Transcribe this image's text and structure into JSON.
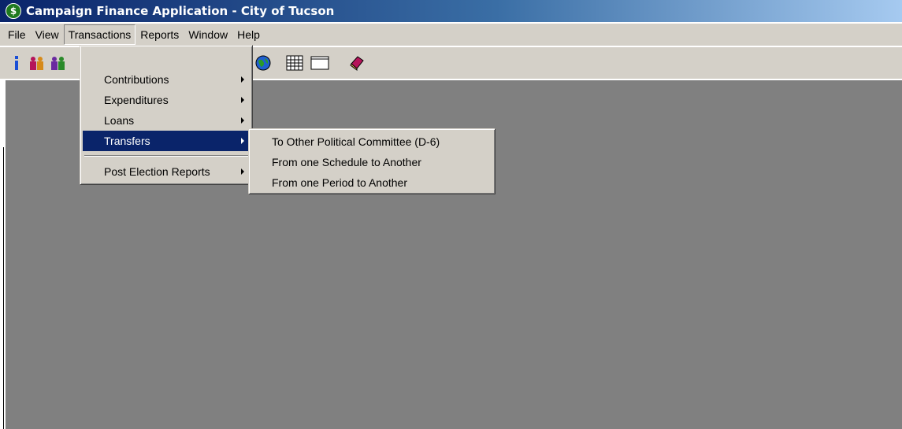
{
  "window": {
    "title": "Campaign Finance Application - City of Tucson",
    "icon": "dollar-globe-icon"
  },
  "menubar": {
    "items": [
      {
        "label": "File"
      },
      {
        "label": "View"
      },
      {
        "label": "Transactions"
      },
      {
        "label": "Reports"
      },
      {
        "label": "Window"
      },
      {
        "label": "Help"
      }
    ]
  },
  "toolbar": {
    "buttons": [
      {
        "icon": "info-icon"
      },
      {
        "icon": "people-icon"
      },
      {
        "icon": "group-icon"
      },
      {
        "icon": "globe-icon"
      },
      {
        "icon": "calendar-grid-icon"
      },
      {
        "icon": "window-icon"
      },
      {
        "icon": "book-icon"
      }
    ]
  },
  "transactions_menu": {
    "items": [
      {
        "label": "Contributions"
      },
      {
        "label": "Expenditures"
      },
      {
        "label": "Loans"
      },
      {
        "label": "Transfers"
      }
    ],
    "post_election": {
      "label": "Post Election Reports"
    }
  },
  "transfers_submenu": {
    "items": [
      {
        "label": "To Other Political Committee (D-6)"
      },
      {
        "label": "From one Schedule to Another"
      },
      {
        "label": "From one Period to Another"
      }
    ]
  },
  "colors": {
    "highlight": "#0a246a",
    "workspace": "#808080",
    "chrome": "#d4d0c8"
  }
}
